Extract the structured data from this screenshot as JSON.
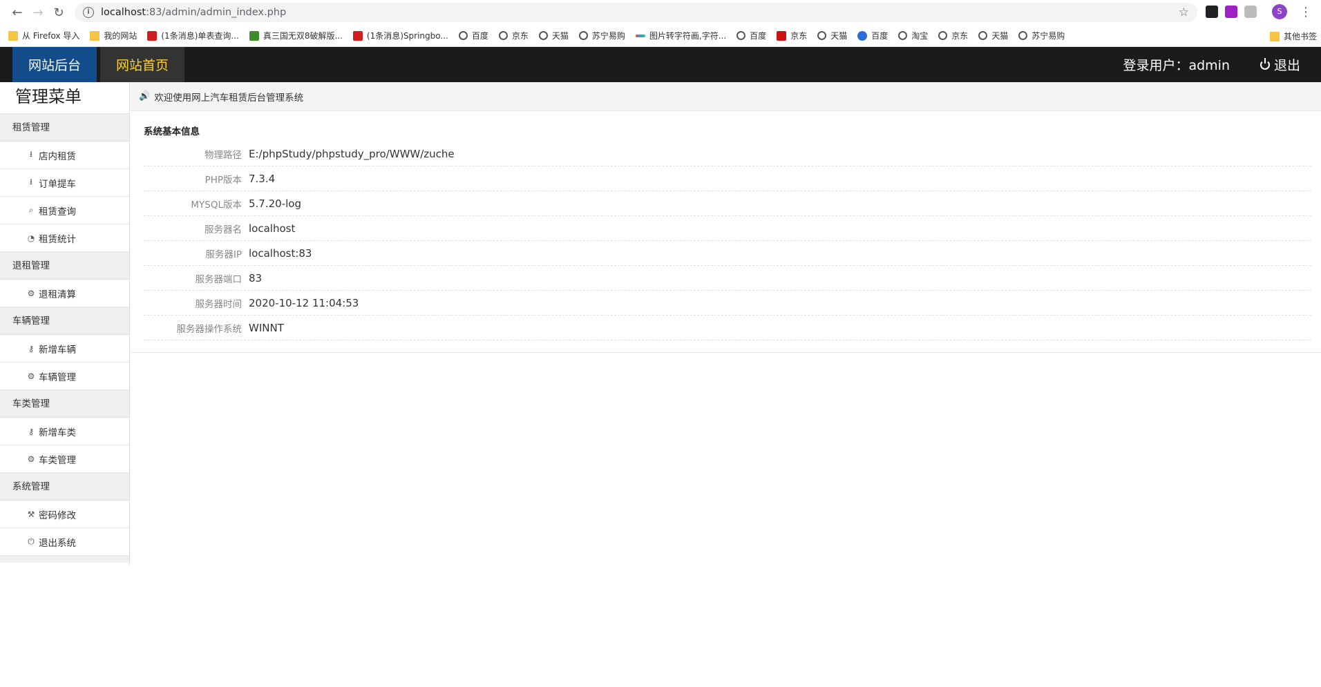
{
  "browser": {
    "url_host": "localhost",
    "url_path": ":83/admin/admin_index.php",
    "profile_initial": "S"
  },
  "bookmarks": [
    {
      "label": "从 Firefox 导入",
      "icon": "folder"
    },
    {
      "label": "我的网站",
      "icon": "folder"
    },
    {
      "label": "(1条消息)单表查询...",
      "icon": "red"
    },
    {
      "label": "真三国无双8破解版...",
      "icon": "green"
    },
    {
      "label": "(1条消息)Springbo...",
      "icon": "red"
    },
    {
      "label": "百度",
      "icon": "globe"
    },
    {
      "label": "京东",
      "icon": "globe"
    },
    {
      "label": "天猫",
      "icon": "globe"
    },
    {
      "label": "苏宁易购",
      "icon": "globe"
    },
    {
      "label": "图片转字符画,字符...",
      "icon": "strip"
    },
    {
      "label": "百度",
      "icon": "globe"
    },
    {
      "label": "京东",
      "icon": "jd"
    },
    {
      "label": "天猫",
      "icon": "globe"
    },
    {
      "label": "百度",
      "icon": "paw"
    },
    {
      "label": "淘宝",
      "icon": "globe"
    },
    {
      "label": "京东",
      "icon": "globe"
    },
    {
      "label": "天猫",
      "icon": "globe"
    },
    {
      "label": "苏宁易购",
      "icon": "globe"
    }
  ],
  "bookmarks_other": "其他书签",
  "header": {
    "brand": "网站后台",
    "home": "网站首页",
    "user": "登录用户：admin",
    "logout": "退出"
  },
  "sidebar": {
    "title": "管理菜单",
    "groups": [
      {
        "label": "租赁管理",
        "items": [
          {
            "label": "店内租赁",
            "icon": "download-icon"
          },
          {
            "label": "订单提车",
            "icon": "download-icon"
          },
          {
            "label": "租赁查询",
            "icon": "search-icon"
          },
          {
            "label": "租赁统计",
            "icon": "pie-chart-icon"
          }
        ]
      },
      {
        "label": "退租管理",
        "items": [
          {
            "label": "退租清算",
            "icon": "gear-icon"
          }
        ]
      },
      {
        "label": "车辆管理",
        "items": [
          {
            "label": "新增车辆",
            "icon": "key-icon"
          },
          {
            "label": "车辆管理",
            "icon": "gear-icon"
          }
        ]
      },
      {
        "label": "车类管理",
        "items": [
          {
            "label": "新增车类",
            "icon": "key-icon"
          },
          {
            "label": "车类管理",
            "icon": "gear-icon"
          }
        ]
      },
      {
        "label": "系统管理",
        "items": [
          {
            "label": "密码修改",
            "icon": "wrench-icon"
          },
          {
            "label": "退出系统",
            "icon": "power-icon"
          }
        ]
      }
    ]
  },
  "main": {
    "notice": "欢迎使用网上汽车租赁后台管理系统",
    "panel_title": "系统基本信息",
    "rows": [
      {
        "label": "物理路径",
        "value": "E:/phpStudy/phpstudy_pro/WWW/zuche"
      },
      {
        "label": "PHP版本",
        "value": "7.3.4"
      },
      {
        "label": "MYSQL版本",
        "value": "5.7.20-log"
      },
      {
        "label": "服务器名",
        "value": "localhost"
      },
      {
        "label": "服务器IP",
        "value": "localhost:83"
      },
      {
        "label": "服务器端口",
        "value": "83"
      },
      {
        "label": "服务器时间",
        "value": "2020-10-12 11:04:53"
      },
      {
        "label": "服务器操作系统",
        "value": "WINNT"
      }
    ]
  }
}
